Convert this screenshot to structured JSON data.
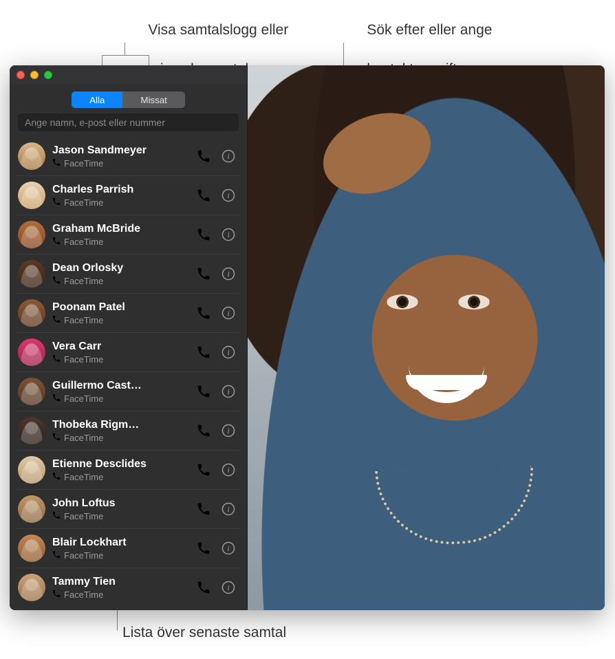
{
  "callouts": {
    "top_left_line1": "Visa samtalslogg eller",
    "top_left_line2": "missade samtal.",
    "top_right_line1": "Sök efter eller ange",
    "top_right_line2": "kontaktuppgifter.",
    "bottom": "Lista över senaste samtal"
  },
  "segmented": {
    "all": "Alla",
    "missed": "Missat"
  },
  "search": {
    "placeholder": "Ange namn, e-post eller nummer",
    "value": ""
  },
  "sublabel": "FaceTime",
  "calls": [
    {
      "name": "Jason Sandmeyer"
    },
    {
      "name": "Charles Parrish"
    },
    {
      "name": "Graham McBride"
    },
    {
      "name": "Dean Orlosky"
    },
    {
      "name": "Poonam Patel"
    },
    {
      "name": "Vera Carr"
    },
    {
      "name": "Guillermo Cast…"
    },
    {
      "name": "Thobeka Rigm…"
    },
    {
      "name": "Etienne Desclides"
    },
    {
      "name": "John Loftus"
    },
    {
      "name": "Blair Lockhart"
    },
    {
      "name": "Tammy Tien"
    }
  ]
}
